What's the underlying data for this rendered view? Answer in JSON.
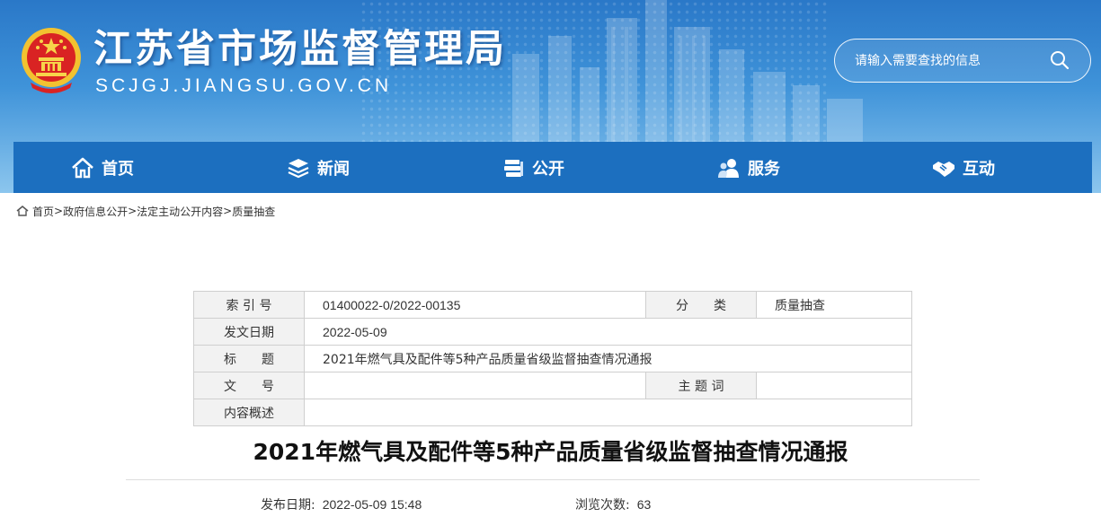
{
  "header": {
    "site_title": "江苏省市场监督管理局",
    "site_domain": "SCJGJ.JIANGSU.GOV.CN",
    "search_placeholder": "请输入需要查找的信息"
  },
  "nav": {
    "items": [
      {
        "label": "首页",
        "icon": "home-icon"
      },
      {
        "label": "新闻",
        "icon": "layers-icon"
      },
      {
        "label": "公开",
        "icon": "books-icon"
      },
      {
        "label": "服务",
        "icon": "users-icon"
      },
      {
        "label": "互动",
        "icon": "handshake-icon"
      }
    ]
  },
  "breadcrumb": {
    "items": [
      "首页",
      "政府信息公开",
      "法定主动公开内容",
      "质量抽查"
    ],
    "separator": ">"
  },
  "meta": {
    "index_label": "索 引 号",
    "index_value": "01400022-0/2022-00135",
    "category_label": "分　　类",
    "category_value": "质量抽查",
    "date_label": "发文日期",
    "date_value": "2022-05-09",
    "title_label": "标　　题",
    "title_value": "2021年燃气具及配件等5种产品质量省级监督抽查情况通报",
    "doc_no_label": "文　　号",
    "doc_no_value": "",
    "subject_label": "主 题 词",
    "subject_value": "",
    "summary_label": "内容概述",
    "summary_value": ""
  },
  "article": {
    "title": "2021年燃气具及配件等5种产品质量省级监督抽查情况通报",
    "publish_label": "发布日期:",
    "publish_value": "2022-05-09 15:48",
    "views_label": "浏览次数:",
    "views_value": "63"
  },
  "colors": {
    "nav_bg": "#1c6fbf",
    "header_top": "#2a78c8",
    "table_label_bg": "#f2f2f2"
  }
}
